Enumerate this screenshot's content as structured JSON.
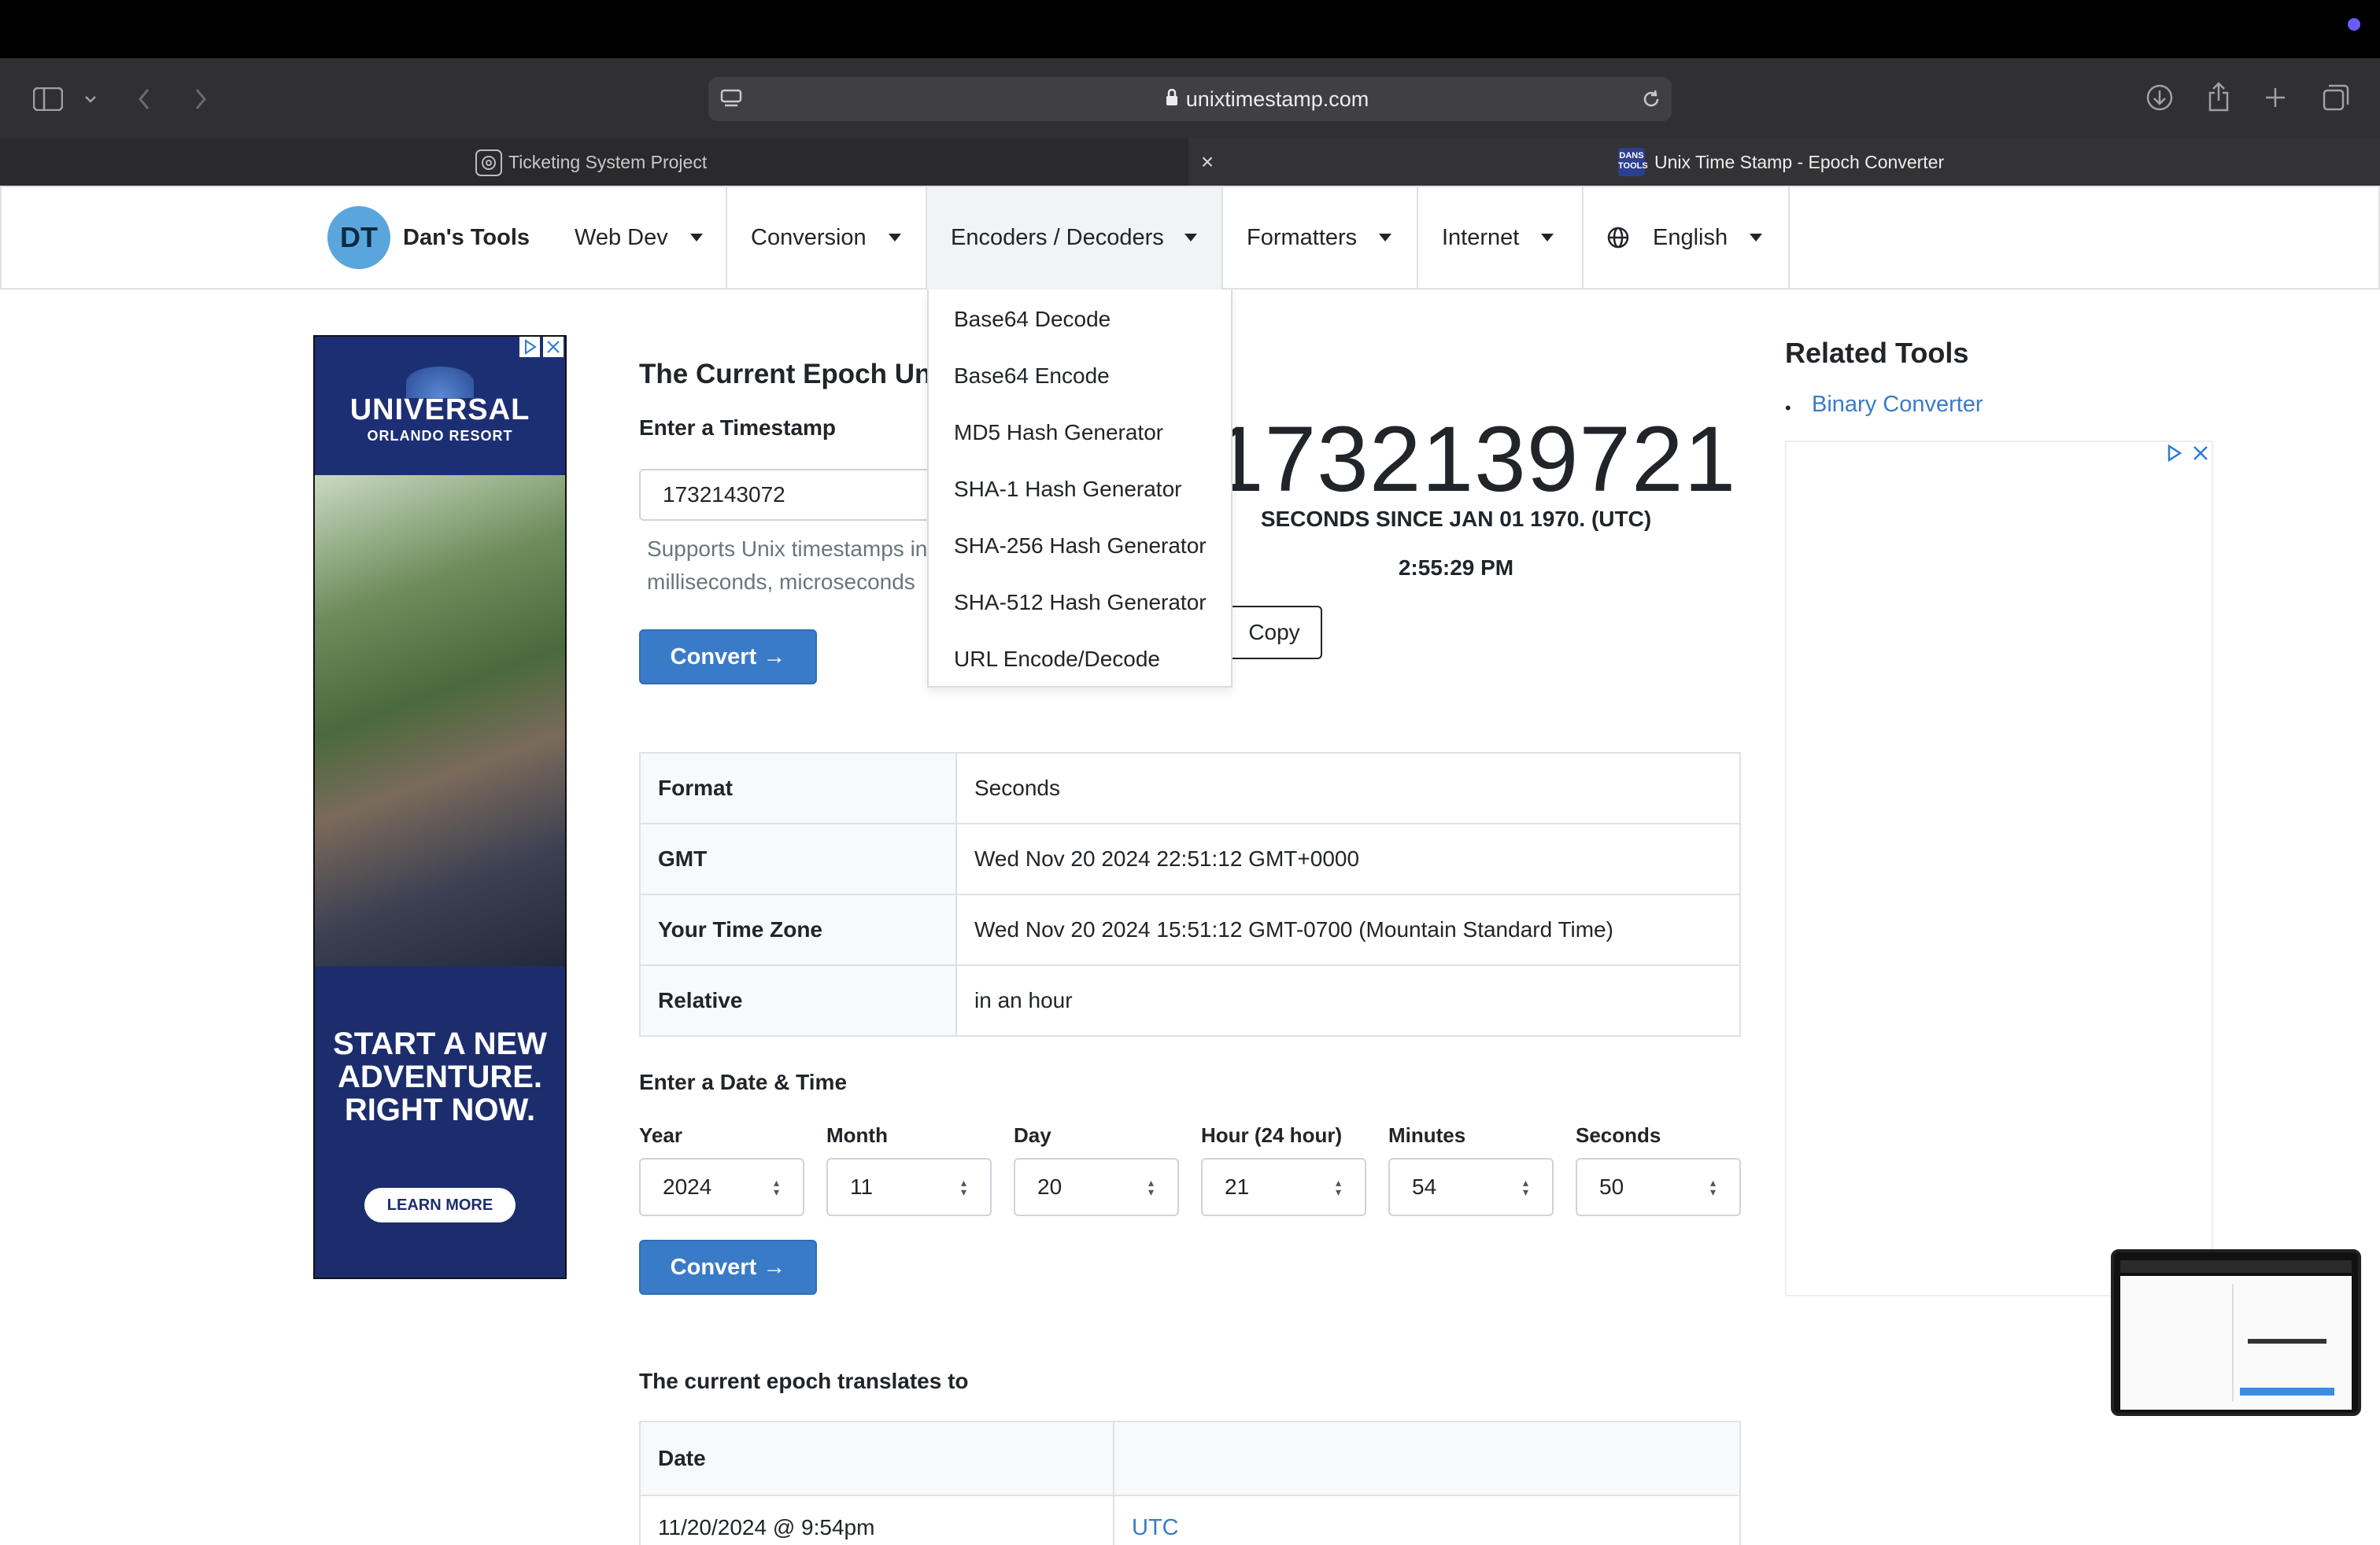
{
  "browser": {
    "url": "unixtimestamp.com",
    "tabs": [
      {
        "label": "Ticketing System Project",
        "active": false
      },
      {
        "label": "Unix Time Stamp - Epoch Converter",
        "active": true
      }
    ],
    "tab_close": "×"
  },
  "nav": {
    "logo_initials": "DT",
    "brand": "Dan's Tools",
    "items": [
      "Web Dev",
      "Conversion",
      "Encoders / Decoders",
      "Formatters",
      "Internet",
      "English"
    ],
    "open_item": "Encoders / Decoders"
  },
  "dropdown": {
    "items": [
      "Base64 Decode",
      "Base64 Encode",
      "MD5 Hash Generator",
      "SHA-1 Hash Generator",
      "SHA-256 Hash Generator",
      "SHA-512 Hash Generator",
      "URL Encode/Decode"
    ]
  },
  "ad_left": {
    "brand": "UNIVERSAL",
    "sub": "ORLANDO RESORT",
    "headline_1": "START A NEW",
    "headline_2": "ADVENTURE.",
    "headline_3": "RIGHT NOW.",
    "cta": "LEARN MORE"
  },
  "main": {
    "title": "The Current Epoch Un",
    "timestamp_label": "Enter a Timestamp",
    "timestamp_value": "1732143072",
    "hint_1": "Supports Unix timestamps in",
    "hint_2": "milliseconds, microseconds",
    "convert_label": "Convert →",
    "current_epoch": "1732139721",
    "epoch_caption": "SECONDS SINCE JAN 01 1970. (UTC)",
    "current_time": "2:55:29 PM",
    "copy_label": "Copy",
    "result_table": [
      {
        "key": "Format",
        "value": "Seconds"
      },
      {
        "key": "GMT",
        "value": "Wed Nov 20 2024 22:51:12 GMT+0000"
      },
      {
        "key": "Your Time Zone",
        "value": "Wed Nov 20 2024 15:51:12 GMT-0700 (Mountain Standard Time)"
      },
      {
        "key": "Relative",
        "value": "in an hour"
      }
    ],
    "datetime_label": "Enter a Date & Time",
    "fields": [
      {
        "label": "Year",
        "value": "2024"
      },
      {
        "label": "Month",
        "value": "11"
      },
      {
        "label": "Day",
        "value": "20"
      },
      {
        "label": "Hour (24 hour)",
        "value": "21"
      },
      {
        "label": "Minutes",
        "value": "54"
      },
      {
        "label": "Seconds",
        "value": "50"
      }
    ],
    "convert2_label": "Convert →",
    "translates_label": "The current epoch translates to",
    "translate_table": {
      "header": "Date",
      "row_date": "11/20/2024 @ 9:54pm",
      "row_zone": "UTC"
    }
  },
  "sidebar": {
    "title": "Related Tools",
    "links": [
      "Binary Converter"
    ]
  },
  "colors": {
    "primary": "#3a7bc8",
    "link": "#3a7bc8",
    "ad_navy": "#1c2d6e"
  }
}
